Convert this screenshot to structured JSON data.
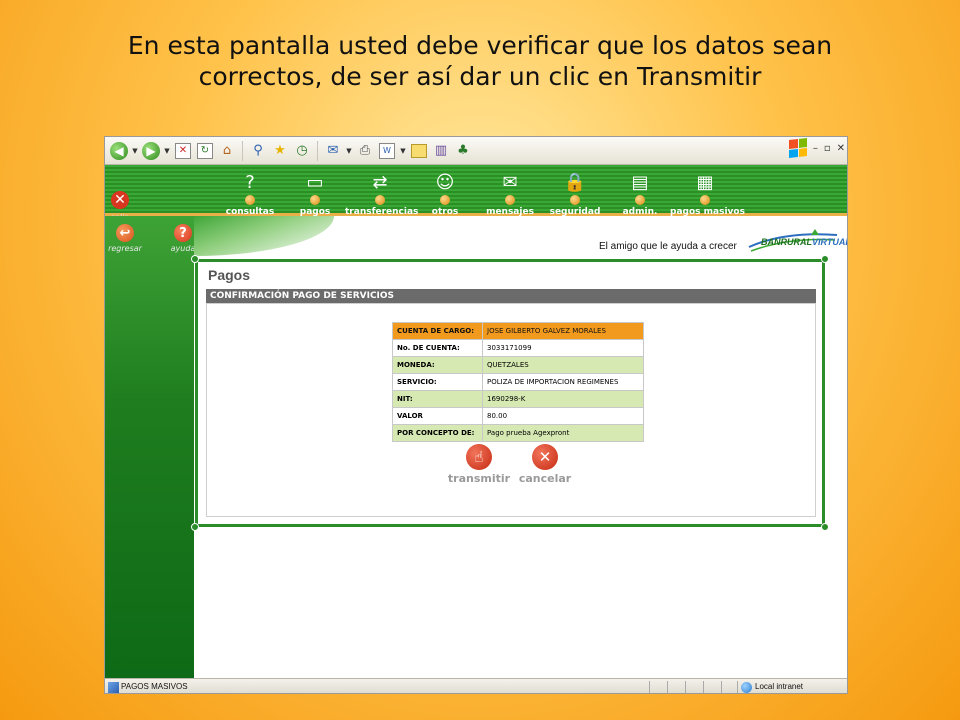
{
  "caption": {
    "line1": "En esta pantalla usted debe verificar que los datos sean",
    "line2": "correctos, de ser así dar un clic en Transmitir"
  },
  "browser": {
    "toolbar_icons": [
      "back-icon",
      "forward-icon",
      "stop-icon",
      "refresh-icon",
      "home-icon",
      "search-icon",
      "favorites-icon",
      "history-icon",
      "mail-icon",
      "print-icon",
      "edit-icon",
      "folder-icon",
      "research-icon",
      "messenger-icon"
    ],
    "status_text": "PAGOS MASIVOS",
    "zone_text": "Local intranet"
  },
  "app": {
    "logout_label": "salir",
    "nav": [
      {
        "label": "consultas",
        "icon": "question-icon",
        "glyph": "?"
      },
      {
        "label": "pagos",
        "icon": "payment-card-icon",
        "glyph": "▭"
      },
      {
        "label": "transferencias",
        "icon": "transfer-icon",
        "glyph": "⇄"
      },
      {
        "label": "otros",
        "icon": "smiley-icon",
        "glyph": "☺"
      },
      {
        "label": "mensajes",
        "icon": "envelope-icon",
        "glyph": "✉"
      },
      {
        "label": "seguridad",
        "icon": "lock-icon",
        "glyph": "🔒"
      },
      {
        "label": "admin.",
        "icon": "admin-docs-icon",
        "glyph": "▤"
      },
      {
        "label": "pagos masivos",
        "icon": "bulk-payments-icon",
        "glyph": "▦"
      }
    ],
    "sidebar": {
      "back_label": "regresar",
      "help_label": "ayuda"
    },
    "tagline": "El amigo que le ayuda a crecer",
    "brand": {
      "part1": "BANRURAL",
      "part2": "VIRTUAL"
    },
    "colors": {
      "brand_green": "#2a8d2a",
      "accent_orange": "#f29a1e",
      "row_green": "#d6e9b3",
      "button_red": "#c52a12"
    }
  },
  "page": {
    "title": "Pagos",
    "section": "CONFIRMACIÓN PAGO DE SERVICIOS",
    "rows": [
      {
        "label": "CUENTA DE CARGO:",
        "value": "JOSE GILBERTO GALVEZ MORALES",
        "style": "orange"
      },
      {
        "label": "No. DE CUENTA:",
        "value": "3033171099",
        "style": "white"
      },
      {
        "label": "MONEDA:",
        "value": "QUETZALES",
        "style": "green"
      },
      {
        "label": "SERVICIO:",
        "value": "POLIZA DE IMPORTACION REGIMENES",
        "style": "white"
      },
      {
        "label": "NIT:",
        "value": "1690298-K",
        "style": "green"
      },
      {
        "label": "VALOR",
        "value": "80.00",
        "style": "white"
      },
      {
        "label": "POR CONCEPTO DE:",
        "value": "Pago prueba Agexpront",
        "style": "green"
      }
    ],
    "actions": {
      "transmit_label": "transmitir",
      "cancel_label": "cancelar"
    }
  }
}
